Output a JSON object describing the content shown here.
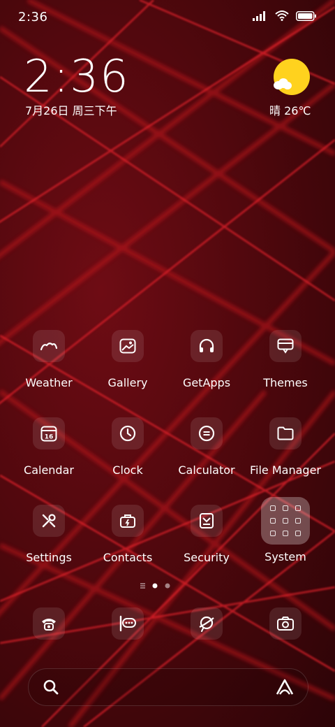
{
  "status_bar": {
    "time": "2:36",
    "signal_icon": "signal-bars-icon",
    "wifi_icon": "wifi-icon",
    "battery_icon": "battery-icon"
  },
  "clock_widget": {
    "time": "2:36",
    "date": "7月26日 周三下午"
  },
  "weather_widget": {
    "condition": "晴",
    "temperature": "晴 26℃",
    "icon": "sunny-partly-cloudy-icon",
    "sun_color": "#ffd21e"
  },
  "apps": [
    {
      "label": "Weather",
      "icon": "weather-icon"
    },
    {
      "label": "Gallery",
      "icon": "gallery-icon"
    },
    {
      "label": "GetApps",
      "icon": "headphones-icon"
    },
    {
      "label": "Themes",
      "icon": "themes-icon"
    },
    {
      "label": "Calendar",
      "icon": "calendar-icon",
      "day": "16"
    },
    {
      "label": "Clock",
      "icon": "clock-icon"
    },
    {
      "label": "Calculator",
      "icon": "calculator-icon"
    },
    {
      "label": "File Manager",
      "icon": "folder-icon"
    },
    {
      "label": "Settings",
      "icon": "settings-tools-icon"
    },
    {
      "label": "Contacts",
      "icon": "contacts-briefcase-icon"
    },
    {
      "label": "Security",
      "icon": "security-shield-icon"
    },
    {
      "label": "System",
      "icon": "system-folder-icon"
    }
  ],
  "pager": {
    "pages": 3,
    "active_page": 2
  },
  "dock": [
    {
      "icon": "phone-icon"
    },
    {
      "icon": "messages-icon"
    },
    {
      "icon": "browser-icon"
    },
    {
      "icon": "camera-icon"
    }
  ],
  "search_bar": {
    "search_icon": "search-icon",
    "assistant_icon": "assistant-logo-icon"
  },
  "colors": {
    "wallpaper_base": "#5a0a0f",
    "wallpaper_line": "#c8141e"
  }
}
